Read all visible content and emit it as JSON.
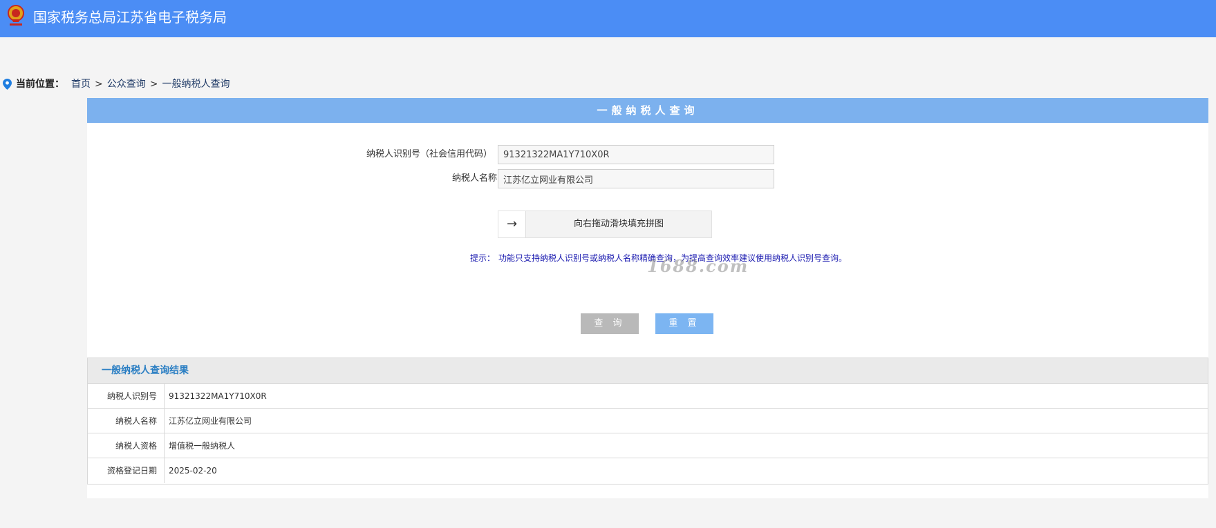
{
  "header": {
    "title": "国家税务总局江苏省电子税务局"
  },
  "breadcrumb": {
    "label": "当前位置：",
    "items": [
      "首页",
      "公众查询",
      "一般纳税人查询"
    ],
    "separator": ">"
  },
  "query_panel": {
    "title": "一般纳税人查询",
    "fields": [
      {
        "label": "纳税人识别号（社会信用代码）",
        "value": "91321322MA1Y710X0R"
      },
      {
        "label": "纳税人名称",
        "value": "江苏亿立网业有限公司"
      }
    ],
    "slider_text": "向右拖动滑块填充拼图",
    "tip_label": "提示：",
    "tip_text": "功能只支持纳税人识别号或纳税人名称精确查询，为提高查询效率建议使用纳税人识别号查询。",
    "query_button": "查 询",
    "reset_button": "重 置"
  },
  "watermark": "1688.com",
  "result": {
    "title": "一般纳税人查询结果",
    "rows": [
      {
        "key": "纳税人识别号",
        "value": "91321322MA1Y710X0R"
      },
      {
        "key": "纳税人名称",
        "value": "江苏亿立网业有限公司"
      },
      {
        "key": "纳税人资格",
        "value": "增值税一般纳税人"
      },
      {
        "key": "资格登记日期",
        "value": "2025-02-20"
      }
    ]
  },
  "colors": {
    "header_bg": "#4b8df5",
    "panel_header_bg": "#7cb1ee",
    "tip_text": "#1b1bb0",
    "result_title": "#2a7ec3",
    "query_button_bg": "#b9b9b9",
    "reset_button_bg": "#7cb5f2"
  }
}
